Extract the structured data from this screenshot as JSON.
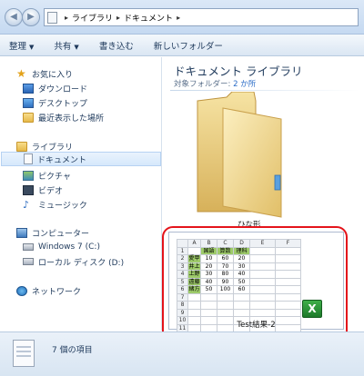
{
  "address": {
    "crumbs": [
      "ライブラリ",
      "ドキュメント"
    ],
    "back_glyph": "◀",
    "forward_glyph": "▶"
  },
  "toolbar": {
    "organize": "整理",
    "share": "共有",
    "burn": "書き込む",
    "new_folder": "新しいフォルダー"
  },
  "nav": {
    "favorites_label": "お気に入り",
    "favorites": [
      "ダウンロード",
      "デスクトップ",
      "最近表示した場所"
    ],
    "libraries_label": "ライブラリ",
    "libraries": [
      "ドキュメント",
      "ピクチャ",
      "ビデオ",
      "ミュージック"
    ],
    "computer_label": "コンピューター",
    "drives": [
      "Windows 7 (C:)",
      "ローカル ディスク (D:)"
    ],
    "network_label": "ネットワーク"
  },
  "content": {
    "title": "ドキュメント ライブラリ",
    "subtitle_prefix": "対象フォルダー:",
    "subtitle_link": "2 か所",
    "folder_label": "ひな形",
    "file_label": "Test結果-2"
  },
  "sheet": {
    "col_headers": [
      "",
      "A",
      "B",
      "C",
      "D",
      "E",
      "F"
    ],
    "header_row": [
      "国語",
      "算数",
      "理科"
    ],
    "rows": [
      {
        "name": "愛甲",
        "vals": [
          "10",
          "60",
          "20"
        ]
      },
      {
        "name": "井上",
        "vals": [
          "20",
          "70",
          "30"
        ]
      },
      {
        "name": "上野",
        "vals": [
          "30",
          "80",
          "40"
        ]
      },
      {
        "name": "遠藤",
        "vals": [
          "40",
          "90",
          "50"
        ]
      },
      {
        "name": "緒方",
        "vals": [
          "50",
          "100",
          "60"
        ]
      }
    ],
    "row_numbers": [
      "1",
      "2",
      "3",
      "4",
      "5",
      "6",
      "7",
      "8",
      "9",
      "10",
      "11"
    ],
    "excel_glyph": "X"
  },
  "status": {
    "count_text": "7 個の項目"
  },
  "colors": {
    "highlight": "#e4141b",
    "sheet_green": "#9ecb6a",
    "excel_green": "#1c7a2a"
  }
}
